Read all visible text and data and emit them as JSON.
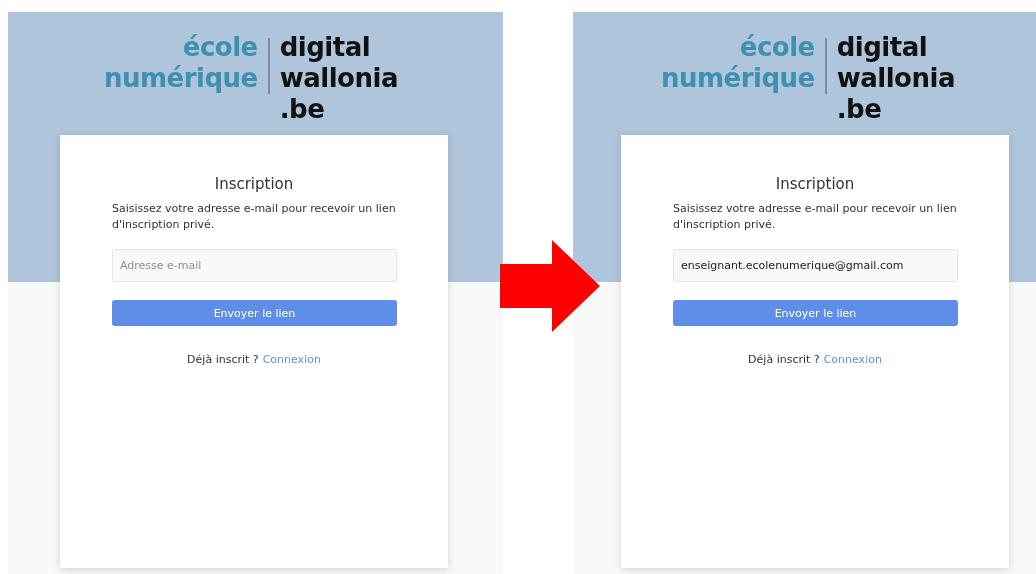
{
  "panels": [
    {
      "logo": {
        "left_lines": [
          "école",
          "numérique"
        ],
        "right_lines": [
          "digital",
          "wallonia",
          ".be"
        ]
      },
      "card": {
        "title": "Inscription",
        "description": "Saisissez votre adresse e-mail pour recevoir un lien d'inscription privé.",
        "email_field": {
          "placeholder": "Adresse e-mail"
        },
        "button": "Envoyer le lien",
        "footer_text": "Déjà inscrit ?",
        "footer_link": "Connexion"
      }
    },
    {
      "logo": {
        "left_lines": [
          "école",
          "numérique"
        ],
        "right_lines": [
          "digital",
          "wallonia",
          ".be"
        ]
      },
      "card": {
        "title": "Inscription",
        "description": "Saisissez votre adresse e-mail pour recevoir un lien d'inscription privé.",
        "email_field": {
          "value": "enseignant.ecolenumerique@gmail.com"
        },
        "button": "Envoyer le lien",
        "footer_text": "Déjà inscrit ?",
        "footer_link": "Connexion"
      }
    }
  ]
}
